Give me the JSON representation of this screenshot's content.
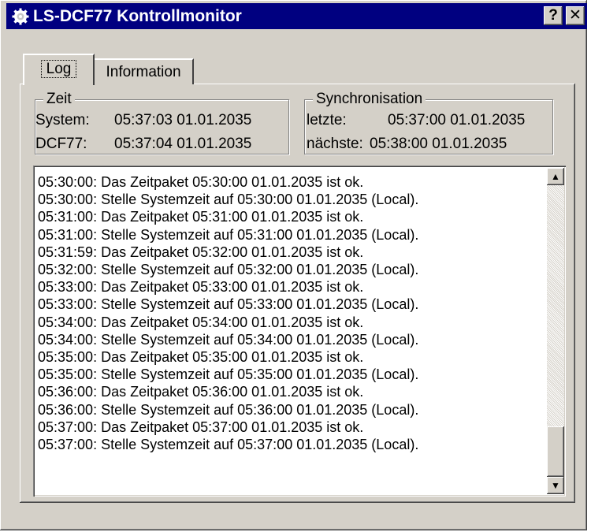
{
  "window": {
    "title": "LS-DCF77 Kontrollmonitor",
    "help_label": "?",
    "close_label": "✕"
  },
  "tabs": [
    {
      "label": "Log",
      "selected": true
    },
    {
      "label": "Information",
      "selected": false
    }
  ],
  "zeit": {
    "legend": "Zeit",
    "system_label": "System:",
    "system_value": "05:37:03 01.01.2035",
    "dcf_label": "DCF77:",
    "dcf_value": "05:37:04 01.01.2035"
  },
  "sync": {
    "legend": "Synchronisation",
    "last_label": "letzte:",
    "last_value": "05:37:00 01.01.2035",
    "next_label": "nächste:",
    "next_value": "05:38:00 01.01.2035"
  },
  "log": [
    "05:30:00: Das Zeitpaket 05:30:00 01.01.2035 ist ok.",
    "05:30:00: Stelle Systemzeit auf 05:30:00 01.01.2035 (Local).",
    "05:31:00: Das Zeitpaket 05:31:00 01.01.2035 ist ok.",
    "05:31:00: Stelle Systemzeit auf 05:31:00 01.01.2035 (Local).",
    "05:31:59: Das Zeitpaket 05:32:00 01.01.2035 ist ok.",
    "05:32:00: Stelle Systemzeit auf 05:32:00 01.01.2035 (Local).",
    "05:33:00: Das Zeitpaket 05:33:00 01.01.2035 ist ok.",
    "05:33:00: Stelle Systemzeit auf 05:33:00 01.01.2035 (Local).",
    "05:34:00: Das Zeitpaket 05:34:00 01.01.2035 ist ok.",
    "05:34:00: Stelle Systemzeit auf 05:34:00 01.01.2035 (Local).",
    "05:35:00: Das Zeitpaket 05:35:00 01.01.2035 ist ok.",
    "05:35:00: Stelle Systemzeit auf 05:35:00 01.01.2035 (Local).",
    "05:36:00: Das Zeitpaket 05:36:00 01.01.2035 ist ok.",
    "05:36:00: Stelle Systemzeit auf 05:36:00 01.01.2035 (Local).",
    "05:37:00: Das Zeitpaket 05:37:00 01.01.2035 ist ok.",
    "05:37:00: Stelle Systemzeit auf 05:37:00 01.01.2035 (Local)."
  ],
  "scrollbar": {
    "up_icon": "scroll-up-arrow-icon",
    "down_icon": "scroll-down-arrow-icon",
    "position_fraction": 1.0
  },
  "colors": {
    "titlebar": "#000080",
    "face": "#d4d0c8"
  }
}
